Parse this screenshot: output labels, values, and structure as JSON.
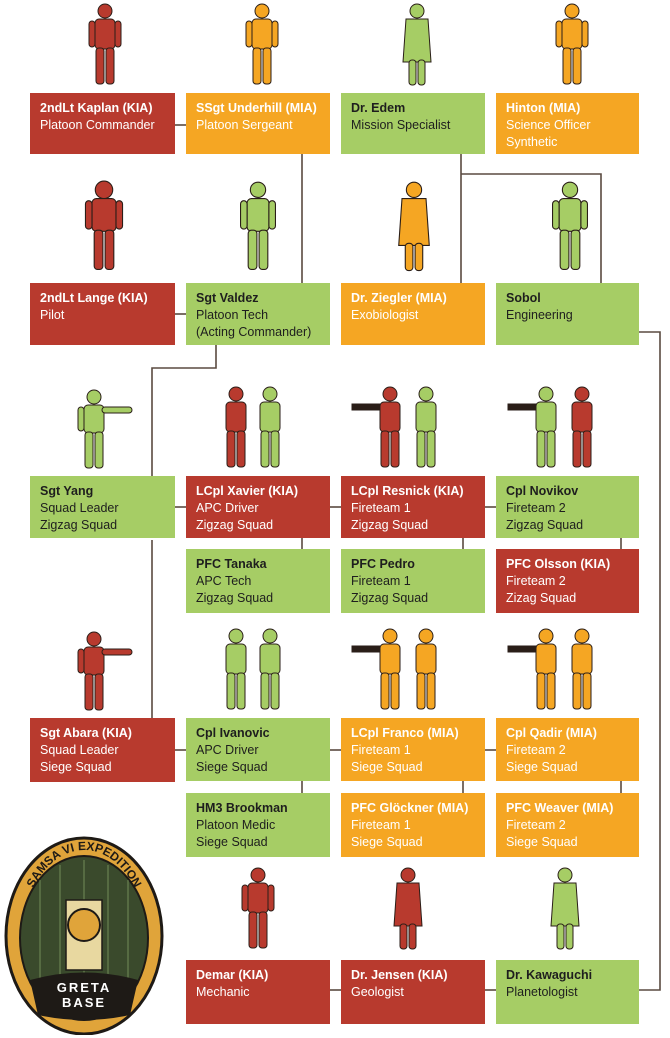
{
  "colors": {
    "kia": "#b83a2e",
    "active": "#a6cd65",
    "mia": "#f5a623",
    "connector": "#5a4a40"
  },
  "seal": {
    "ring_text": "SAMSA VI EXPEDITION",
    "base_line1": "GRETA",
    "base_line2": "BASE"
  },
  "cards": {
    "kaplan": {
      "status": "kia",
      "name": "2ndLt Kaplan (KIA)",
      "lines": [
        "Platoon Commander"
      ]
    },
    "underhill": {
      "status": "mia",
      "name": "SSgt Underhill (MIA)",
      "lines": [
        "Platoon Sergeant"
      ]
    },
    "edem": {
      "status": "active",
      "name": "Dr. Edem",
      "lines": [
        "Mission Specialist"
      ]
    },
    "hinton": {
      "status": "mia",
      "name": "Hinton (MIA)",
      "lines": [
        "Science Officer",
        "Synthetic"
      ]
    },
    "lange": {
      "status": "kia",
      "name": "2ndLt Lange (KIA)",
      "lines": [
        "Pilot"
      ]
    },
    "valdez": {
      "status": "active",
      "name": "Sgt Valdez",
      "lines": [
        "Platoon Tech",
        "(Acting Commander)"
      ]
    },
    "ziegler": {
      "status": "mia",
      "name": "Dr. Ziegler (MIA)",
      "lines": [
        "Exobiologist"
      ]
    },
    "sobol": {
      "status": "active",
      "name": "Sobol",
      "lines": [
        "Engineering"
      ]
    },
    "yang": {
      "status": "active",
      "name": "Sgt Yang",
      "lines": [
        "Squad Leader",
        "Zigzag Squad"
      ]
    },
    "xavier": {
      "status": "kia",
      "name": "LCpl Xavier (KIA)",
      "lines": [
        "APC Driver",
        "Zigzag Squad"
      ]
    },
    "resnick": {
      "status": "kia",
      "name": "LCpl Resnick (KIA)",
      "lines": [
        "Fireteam 1",
        "Zigzag Squad"
      ]
    },
    "novikov": {
      "status": "active",
      "name": "Cpl Novikov",
      "lines": [
        "Fireteam 2",
        "Zigzag Squad"
      ]
    },
    "tanaka": {
      "status": "active",
      "name": "PFC Tanaka",
      "lines": [
        "APC Tech",
        "Zigzag Squad"
      ]
    },
    "pedro": {
      "status": "active",
      "name": "PFC Pedro",
      "lines": [
        "Fireteam 1",
        "Zigzag Squad"
      ]
    },
    "olsson": {
      "status": "kia",
      "name": "PFC Olsson (KIA)",
      "lines": [
        "Fireteam 2",
        "Zizag Squad"
      ]
    },
    "abara": {
      "status": "kia",
      "name": "Sgt Abara (KIA)",
      "lines": [
        "Squad Leader",
        "Siege Squad"
      ]
    },
    "ivanovic": {
      "status": "active",
      "name": "Cpl Ivanovic",
      "lines": [
        "APC Driver",
        "Siege Squad"
      ]
    },
    "franco": {
      "status": "mia",
      "name": "LCpl Franco (MIA)",
      "lines": [
        "Fireteam 1",
        "Siege Squad"
      ]
    },
    "qadir": {
      "status": "mia",
      "name": "Cpl Qadir (MIA)",
      "lines": [
        "Fireteam 2",
        "Siege Squad"
      ]
    },
    "brookman": {
      "status": "active",
      "name": "HM3 Brookman",
      "lines": [
        "Platoon Medic",
        "Siege Squad"
      ]
    },
    "glockner": {
      "status": "mia",
      "name": "PFC Glöckner (MIA)",
      "lines": [
        "Fireteam 1",
        "Siege Squad"
      ]
    },
    "weaver": {
      "status": "mia",
      "name": "PFC Weaver (MIA)",
      "lines": [
        "Fireteam 2",
        "Siege Squad"
      ]
    },
    "demar": {
      "status": "kia",
      "name": "Demar (KIA)",
      "lines": [
        "Mechanic"
      ]
    },
    "jensen": {
      "status": "kia",
      "name": "Dr. Jensen (KIA)",
      "lines": [
        "Geologist"
      ]
    },
    "kawaguchi": {
      "status": "active",
      "name": "Dr. Kawaguchi",
      "lines": [
        "Planetologist"
      ]
    }
  }
}
